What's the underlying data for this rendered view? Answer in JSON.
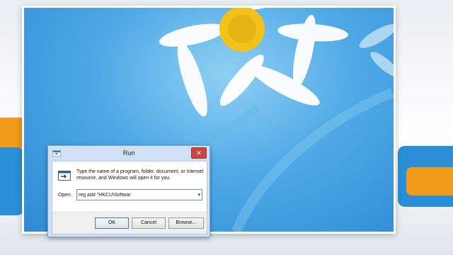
{
  "dialog": {
    "title": "Run",
    "close_symbol": "✕",
    "description": "Type the name of a program, folder, document, or Internet resource, and Windows will open it for you.",
    "open_label": "Open:",
    "open_value": "reg add \"HKCU\\Softwar",
    "buttons": {
      "ok": "OK",
      "cancel": "Cancel",
      "browse": "Browse..."
    }
  },
  "icons": {
    "title_icon": "run-icon",
    "dialog_icon": "run-icon",
    "dropdown": "chevron-down-icon",
    "close": "close-icon"
  },
  "colors": {
    "dialog_frame": "#cfe1f7",
    "close_button": "#c9473f",
    "wallpaper": "#4fa9e6"
  }
}
